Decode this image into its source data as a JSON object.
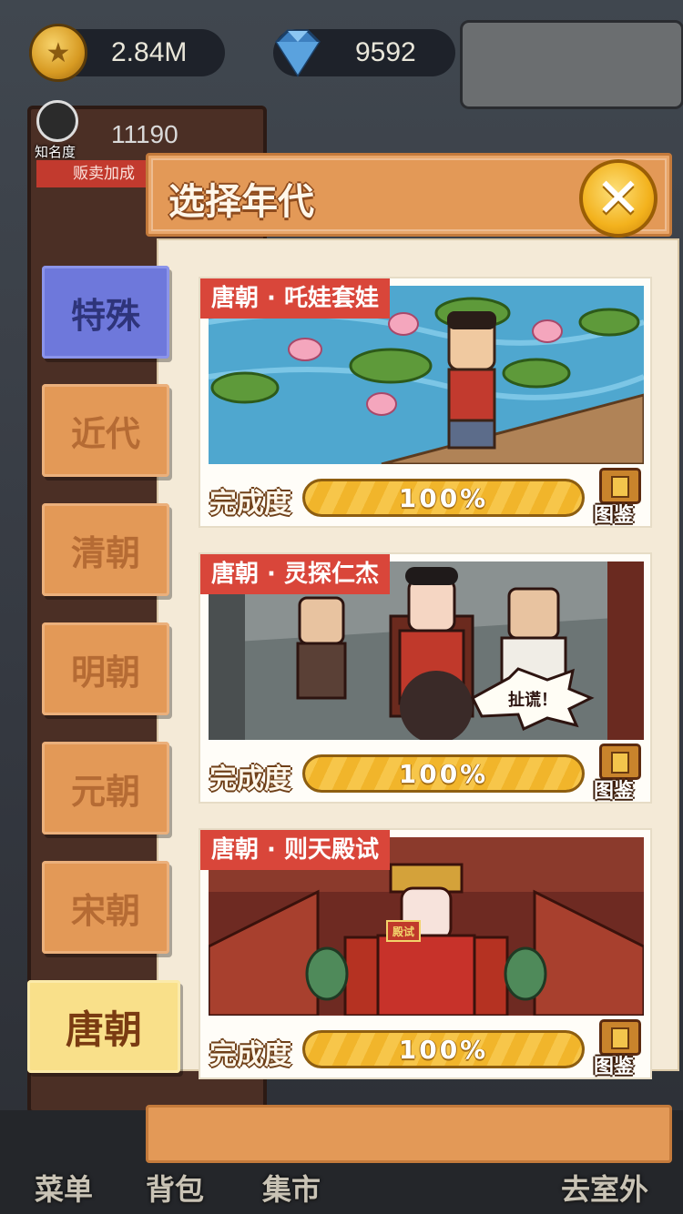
{
  "hud": {
    "coins": "2.84M",
    "gems": "9592",
    "fame_label": "知名度",
    "fame_value": "11190",
    "sell_bonus": "贩卖加成"
  },
  "bottom_nav": {
    "menu": "菜单",
    "backpack": "背包",
    "market": "集市",
    "outdoor": "去室外"
  },
  "dialog": {
    "title": "选择年代",
    "close_icon": "close-x-icon"
  },
  "eras": [
    {
      "label": "特殊",
      "state": "special"
    },
    {
      "label": "近代",
      "state": "normal"
    },
    {
      "label": "清朝",
      "state": "normal"
    },
    {
      "label": "明朝",
      "state": "normal"
    },
    {
      "label": "元朝",
      "state": "normal"
    },
    {
      "label": "宋朝",
      "state": "normal"
    },
    {
      "label": "唐朝",
      "state": "selected"
    }
  ],
  "stages": [
    {
      "title": "唐朝 · 吒娃套娃",
      "progress_label": "完成度",
      "progress_text": "100%",
      "progress": 1.0,
      "album_label": "图鉴"
    },
    {
      "title": "唐朝 · 灵探仁杰",
      "progress_label": "完成度",
      "progress_text": "100%",
      "progress": 1.0,
      "album_label": "图鉴",
      "speech": "扯谎！"
    },
    {
      "title": "唐朝 · 则天殿试",
      "progress_label": "完成度",
      "progress_text": "100%",
      "progress": 1.0,
      "album_label": "图鉴",
      "plaque": "殿试"
    }
  ]
}
